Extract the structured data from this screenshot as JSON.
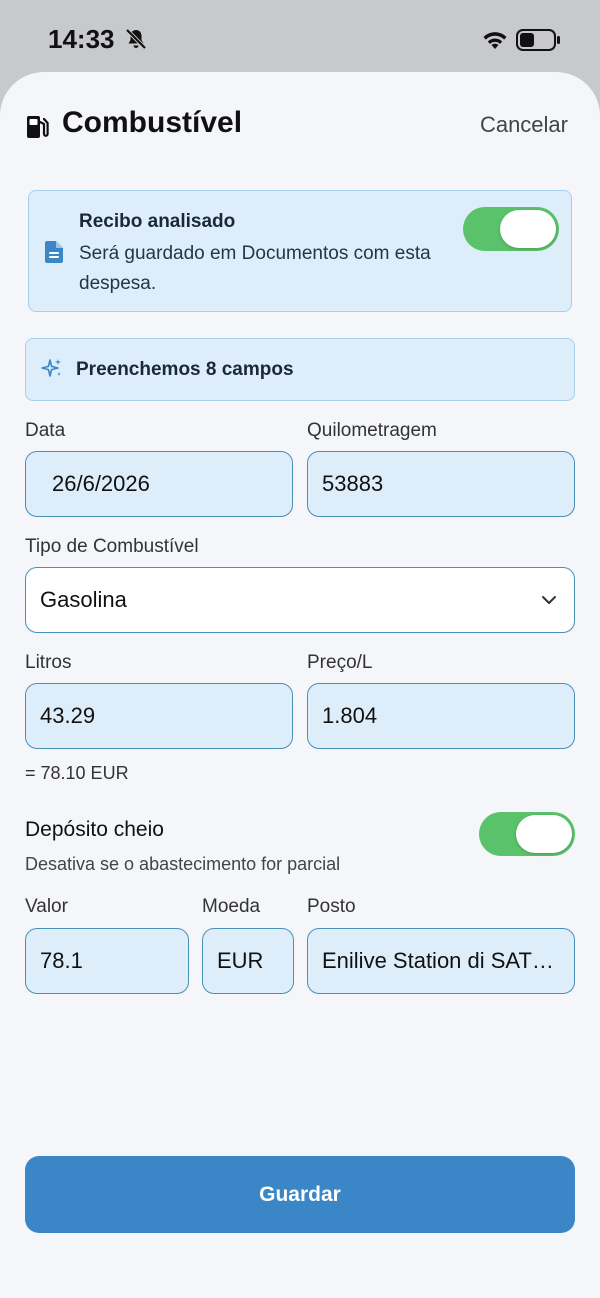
{
  "status_bar": {
    "time": "14:33"
  },
  "header": {
    "title": "Combustível",
    "cancel_label": "Cancelar"
  },
  "receipt": {
    "title": "Recibo analisado",
    "description": "Será guardado em Documentos com esta despesa.",
    "toggle_on": true
  },
  "autofill": {
    "text": "Preenchemos 8 campos"
  },
  "form": {
    "date_label": "Data",
    "date_value": "26/6/2026",
    "mileage_label": "Quilometragem",
    "mileage_value": "53883",
    "fuel_type_label": "Tipo de Combustível",
    "fuel_type_value": "Gasolina",
    "liters_label": "Litros",
    "liters_value": "43.29",
    "price_label": "Preço/L",
    "price_value": "1.804",
    "total_text": "= 78.10 EUR",
    "full_tank_label": "Depósito cheio",
    "full_tank_desc": "Desativa se o abastecimento for parcial",
    "full_tank_on": true,
    "amount_label": "Valor",
    "amount_value": "78.1",
    "currency_label": "Moeda",
    "currency_value": "EUR",
    "station_label": "Posto",
    "station_value": "Enilive Station di SAT…"
  },
  "save_label": "Guardar",
  "colors": {
    "accent": "#3b86c6",
    "toggle_on": "#5ac26a",
    "field_bg": "#ddeefa",
    "field_border": "#4a8fb8"
  }
}
